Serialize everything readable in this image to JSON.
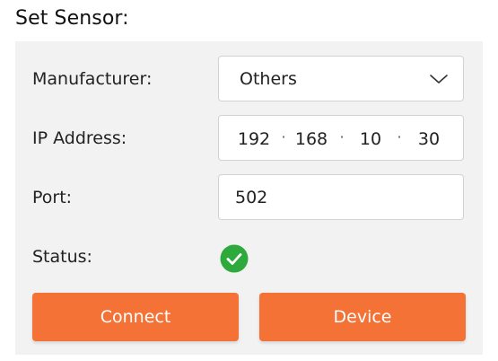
{
  "title": "Set Sensor:",
  "manufacturer": {
    "label": "Manufacturer:",
    "value": "Others",
    "icon": "chevron-down-icon"
  },
  "ip": {
    "label": "IP Address:",
    "octets": [
      "192",
      "168",
      "10",
      "30"
    ],
    "separator": "·"
  },
  "port": {
    "label": "Port:",
    "value": "502"
  },
  "status": {
    "label": "Status:",
    "icon": "check-circle-icon",
    "color": "#2eaa3c"
  },
  "buttons": {
    "connect": "Connect",
    "device": "Device",
    "color": "#f57236"
  }
}
